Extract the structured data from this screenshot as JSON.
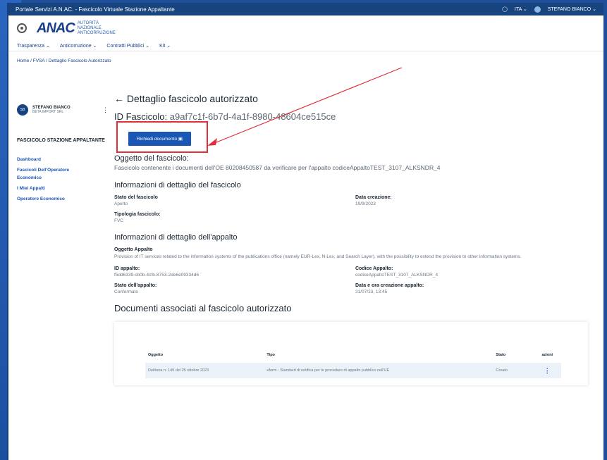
{
  "topbar": {
    "title": "Portale Servizi A.N.AC. - Fascicolo Virtuale Stazione Appaltante",
    "lang": "ITA",
    "user": "STEFANO BIANCO"
  },
  "header": {
    "logo_mark": "ANAC",
    "logo_sub": [
      "AUTORITÀ",
      "NAZIONALE",
      "ANTICORRUZIONE"
    ]
  },
  "menu": [
    "Trasparenza",
    "Anticorruzione",
    "Contratti Pubblici",
    "Kit"
  ],
  "breadcrumb": "Home / FVSA / Dettaglio Fascicolo Autorizzato",
  "sidebar": {
    "user_initials": "SB",
    "user_name": "STEFANO BIANCO",
    "user_org": "BETA IMPORT SRL",
    "section": "FASCICOLO STAZIONE APPALTANTE",
    "links": [
      "Dashboard",
      "Fascicoli Dell'Operatore Economico",
      "I Miei Appalti",
      "Operatore Economico"
    ]
  },
  "main": {
    "title": "Dettaglio fascicolo autorizzato",
    "id_label": "ID Fascicolo:",
    "id_value": "a9af7c1f-6b7d-4a1f-8980-48604ce515ce",
    "button_label": "Richiedi documento",
    "oggetto_heading": "Oggetto del fascicolo:",
    "oggetto_text": "Fascicolo contenente i documenti dell'OE 80208450587 da verificare per l'appalto codiceAppaltoTEST_3107_ALKSNDR_4",
    "fascicolo_heading": "Informazioni di dettaglio del fascicolo",
    "stato_label": "Stato del fascicolo",
    "stato_value": "Aperto",
    "data_label": "Data creazione:",
    "data_value": "19/9/2023",
    "tipologia_label": "Tipologia fascicolo:",
    "tipologia_value": "FVC",
    "appalto_heading": "Informazioni di dettaglio dell'appalto",
    "oggetto_appalto_label": "Oggetto Appalto",
    "oggetto_appalto_text": "Provision of IT services related to the information systems of the publications office (namely EUR-Lex, N-Lex, and Search Layer), with the possibility to extend the provision to other information systems.",
    "id_appalto_label": "ID appalto:",
    "id_appalto_value": "f5dd6339-cb0b-4cfb-8753-2de6e09334d6",
    "codice_label": "Codice Appalto:",
    "codice_value": "codiceAppaltoTEST_3107_ALKSNDR_4",
    "stato_appalto_label": "Stato dell'appalto:",
    "stato_appalto_value": "Confermato",
    "data_appalto_label": "Data e ora creazione appalto:",
    "data_appalto_value": "31/07/23, 13:45",
    "documenti_heading": "Documenti associati al fascicolo autorizzato"
  },
  "table": {
    "headers": [
      "Oggetto",
      "Tipo",
      "Stato",
      "azioni"
    ],
    "rows": [
      [
        "Delibera n. 145 del 25 ottobre 2023",
        "eform - Standard di notifica per le procedure di appalto pubblico nell'UE",
        "Creato",
        "⋮"
      ]
    ]
  },
  "colors": {
    "primary": "#1a56b3",
    "topbar": "#17447f",
    "annotation": "#e0303a"
  }
}
